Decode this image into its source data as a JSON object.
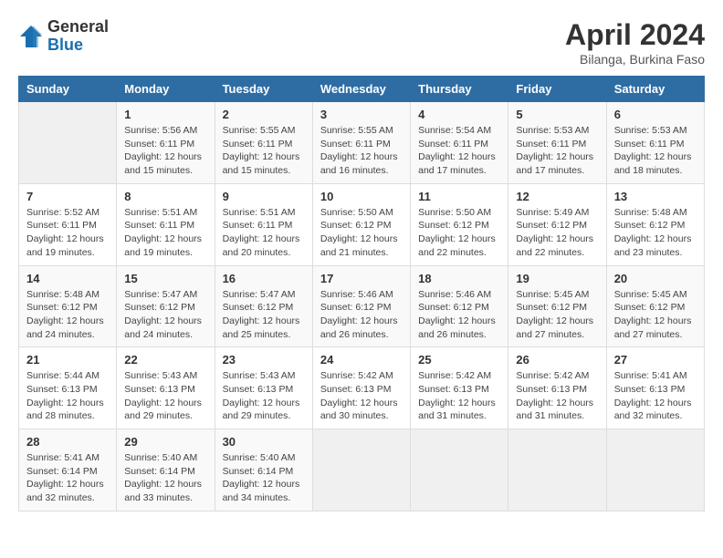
{
  "header": {
    "logo_general": "General",
    "logo_blue": "Blue",
    "month_title": "April 2024",
    "location": "Bilanga, Burkina Faso"
  },
  "calendar": {
    "days_of_week": [
      "Sunday",
      "Monday",
      "Tuesday",
      "Wednesday",
      "Thursday",
      "Friday",
      "Saturday"
    ],
    "weeks": [
      [
        {
          "num": "",
          "info": ""
        },
        {
          "num": "1",
          "info": "Sunrise: 5:56 AM\nSunset: 6:11 PM\nDaylight: 12 hours\nand 15 minutes."
        },
        {
          "num": "2",
          "info": "Sunrise: 5:55 AM\nSunset: 6:11 PM\nDaylight: 12 hours\nand 15 minutes."
        },
        {
          "num": "3",
          "info": "Sunrise: 5:55 AM\nSunset: 6:11 PM\nDaylight: 12 hours\nand 16 minutes."
        },
        {
          "num": "4",
          "info": "Sunrise: 5:54 AM\nSunset: 6:11 PM\nDaylight: 12 hours\nand 17 minutes."
        },
        {
          "num": "5",
          "info": "Sunrise: 5:53 AM\nSunset: 6:11 PM\nDaylight: 12 hours\nand 17 minutes."
        },
        {
          "num": "6",
          "info": "Sunrise: 5:53 AM\nSunset: 6:11 PM\nDaylight: 12 hours\nand 18 minutes."
        }
      ],
      [
        {
          "num": "7",
          "info": "Sunrise: 5:52 AM\nSunset: 6:11 PM\nDaylight: 12 hours\nand 19 minutes."
        },
        {
          "num": "8",
          "info": "Sunrise: 5:51 AM\nSunset: 6:11 PM\nDaylight: 12 hours\nand 19 minutes."
        },
        {
          "num": "9",
          "info": "Sunrise: 5:51 AM\nSunset: 6:11 PM\nDaylight: 12 hours\nand 20 minutes."
        },
        {
          "num": "10",
          "info": "Sunrise: 5:50 AM\nSunset: 6:12 PM\nDaylight: 12 hours\nand 21 minutes."
        },
        {
          "num": "11",
          "info": "Sunrise: 5:50 AM\nSunset: 6:12 PM\nDaylight: 12 hours\nand 22 minutes."
        },
        {
          "num": "12",
          "info": "Sunrise: 5:49 AM\nSunset: 6:12 PM\nDaylight: 12 hours\nand 22 minutes."
        },
        {
          "num": "13",
          "info": "Sunrise: 5:48 AM\nSunset: 6:12 PM\nDaylight: 12 hours\nand 23 minutes."
        }
      ],
      [
        {
          "num": "14",
          "info": "Sunrise: 5:48 AM\nSunset: 6:12 PM\nDaylight: 12 hours\nand 24 minutes."
        },
        {
          "num": "15",
          "info": "Sunrise: 5:47 AM\nSunset: 6:12 PM\nDaylight: 12 hours\nand 24 minutes."
        },
        {
          "num": "16",
          "info": "Sunrise: 5:47 AM\nSunset: 6:12 PM\nDaylight: 12 hours\nand 25 minutes."
        },
        {
          "num": "17",
          "info": "Sunrise: 5:46 AM\nSunset: 6:12 PM\nDaylight: 12 hours\nand 26 minutes."
        },
        {
          "num": "18",
          "info": "Sunrise: 5:46 AM\nSunset: 6:12 PM\nDaylight: 12 hours\nand 26 minutes."
        },
        {
          "num": "19",
          "info": "Sunrise: 5:45 AM\nSunset: 6:12 PM\nDaylight: 12 hours\nand 27 minutes."
        },
        {
          "num": "20",
          "info": "Sunrise: 5:45 AM\nSunset: 6:12 PM\nDaylight: 12 hours\nand 27 minutes."
        }
      ],
      [
        {
          "num": "21",
          "info": "Sunrise: 5:44 AM\nSunset: 6:13 PM\nDaylight: 12 hours\nand 28 minutes."
        },
        {
          "num": "22",
          "info": "Sunrise: 5:43 AM\nSunset: 6:13 PM\nDaylight: 12 hours\nand 29 minutes."
        },
        {
          "num": "23",
          "info": "Sunrise: 5:43 AM\nSunset: 6:13 PM\nDaylight: 12 hours\nand 29 minutes."
        },
        {
          "num": "24",
          "info": "Sunrise: 5:42 AM\nSunset: 6:13 PM\nDaylight: 12 hours\nand 30 minutes."
        },
        {
          "num": "25",
          "info": "Sunrise: 5:42 AM\nSunset: 6:13 PM\nDaylight: 12 hours\nand 31 minutes."
        },
        {
          "num": "26",
          "info": "Sunrise: 5:42 AM\nSunset: 6:13 PM\nDaylight: 12 hours\nand 31 minutes."
        },
        {
          "num": "27",
          "info": "Sunrise: 5:41 AM\nSunset: 6:13 PM\nDaylight: 12 hours\nand 32 minutes."
        }
      ],
      [
        {
          "num": "28",
          "info": "Sunrise: 5:41 AM\nSunset: 6:14 PM\nDaylight: 12 hours\nand 32 minutes."
        },
        {
          "num": "29",
          "info": "Sunrise: 5:40 AM\nSunset: 6:14 PM\nDaylight: 12 hours\nand 33 minutes."
        },
        {
          "num": "30",
          "info": "Sunrise: 5:40 AM\nSunset: 6:14 PM\nDaylight: 12 hours\nand 34 minutes."
        },
        {
          "num": "",
          "info": ""
        },
        {
          "num": "",
          "info": ""
        },
        {
          "num": "",
          "info": ""
        },
        {
          "num": "",
          "info": ""
        }
      ]
    ]
  }
}
